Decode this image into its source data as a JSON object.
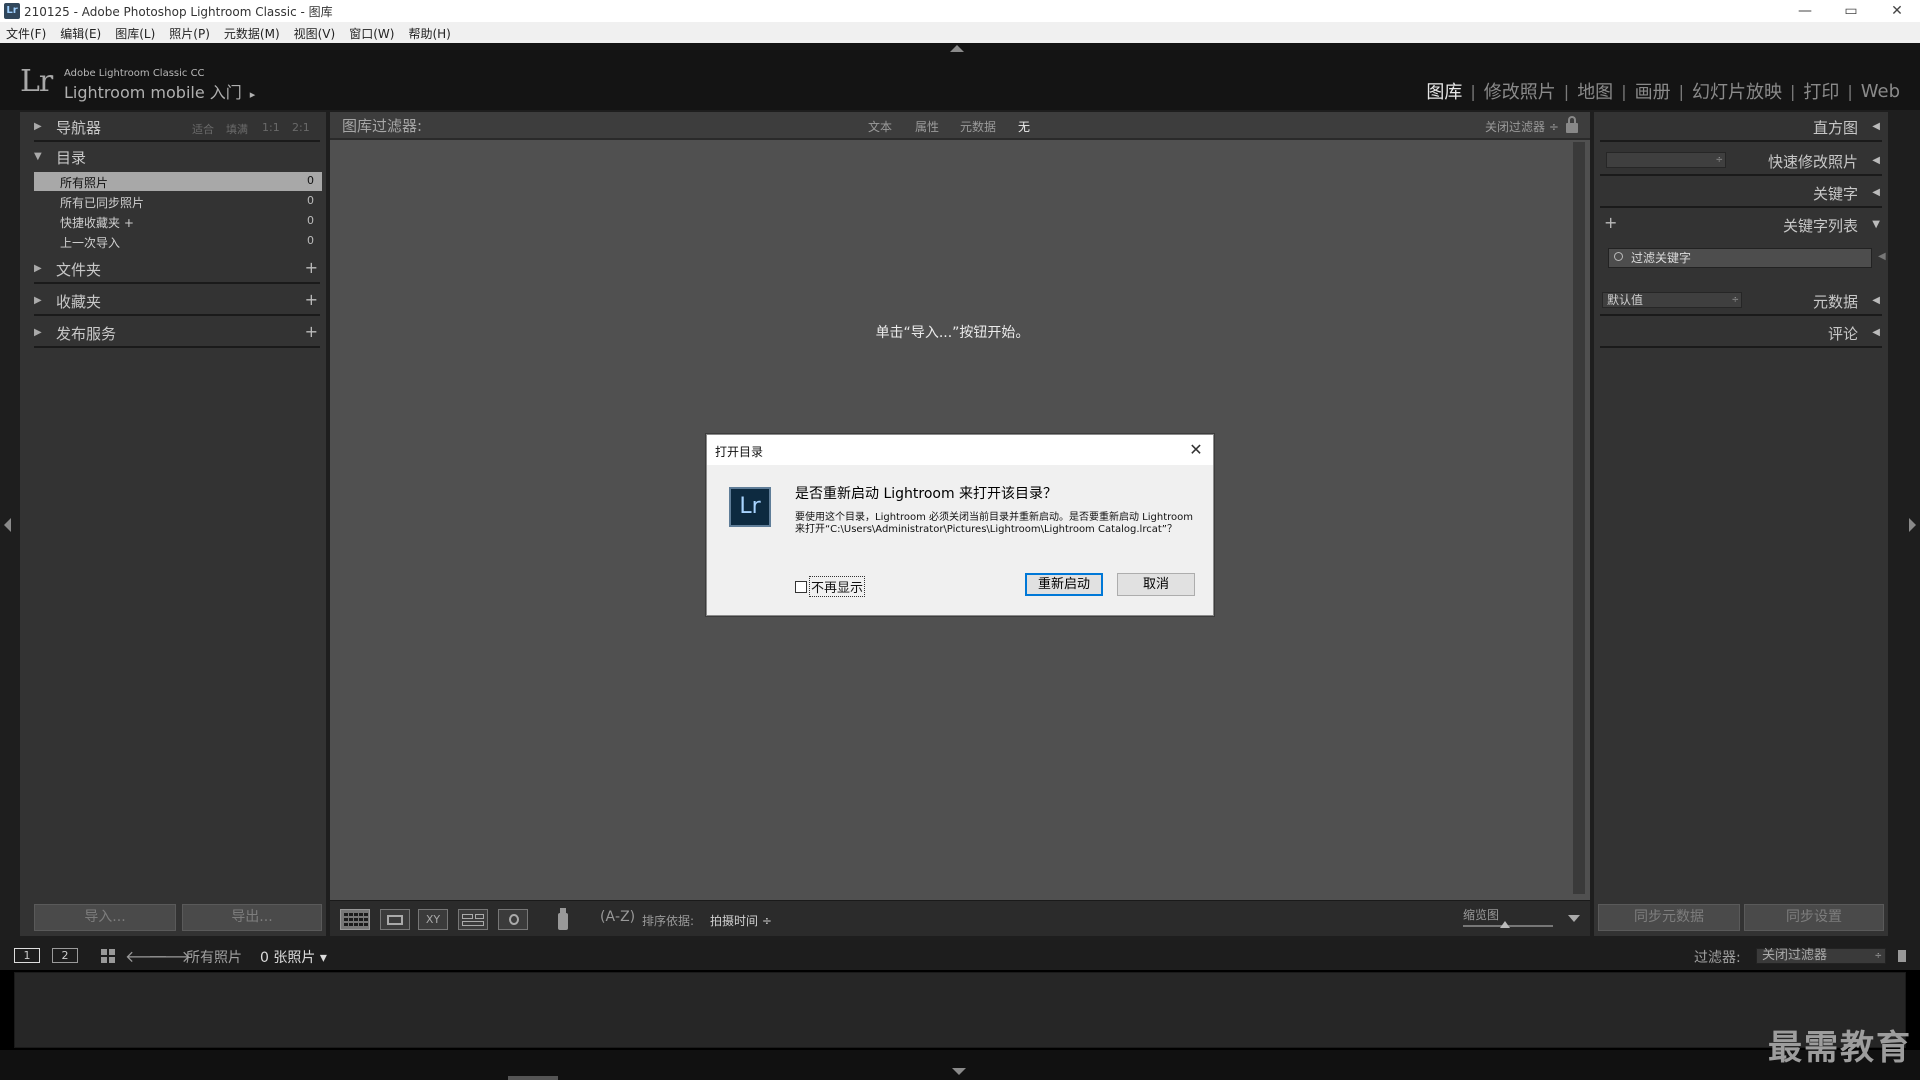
{
  "window": {
    "app_icon": "Lr",
    "title": "210125 - Adobe Photoshop Lightroom Classic - 图库",
    "controls": [
      "—",
      "▭",
      "✕"
    ]
  },
  "menu": [
    "文件(F)",
    "编辑(E)",
    "图库(L)",
    "照片(P)",
    "元数据(M)",
    "视图(V)",
    "窗口(W)",
    "帮助(H)"
  ],
  "identity": {
    "logo": "Lr",
    "product": "Adobe Lightroom Classic CC",
    "mobile": "Lightroom mobile 入门",
    "arrow": "▸"
  },
  "modules": [
    {
      "label": "图库",
      "active": true
    },
    {
      "label": "修改照片"
    },
    {
      "label": "地图"
    },
    {
      "label": "画册"
    },
    {
      "label": "幻灯片放映"
    },
    {
      "label": "打印"
    },
    {
      "label": "Web"
    }
  ],
  "module_separator": "|",
  "left_panel": {
    "navigator": {
      "label": "导航器",
      "zoom": [
        "适合",
        "填满",
        "1:1",
        "2:1"
      ]
    },
    "catalog": {
      "label": "目录",
      "items": [
        {
          "name": "所有照片",
          "count": "0",
          "selected": true
        },
        {
          "name": "所有已同步照片",
          "count": "0"
        },
        {
          "name": "快捷收藏夹 +",
          "count": "0"
        },
        {
          "name": "上一次导入",
          "count": "0"
        }
      ]
    },
    "folders": "文件夹",
    "collections": "收藏夹",
    "publish": "发布服务",
    "plus": "+",
    "import_button": "导入...",
    "export_button": "导出..."
  },
  "filter_bar": {
    "title": "图库过滤器:",
    "options": [
      "文本",
      "属性",
      "元数据",
      "无"
    ],
    "active_option": "无",
    "preset": "关闭过滤器 ÷"
  },
  "center": {
    "hint": "单击“导入...”按钮开始。"
  },
  "toolbar": {
    "compare_label": "XY",
    "sort_icon": "(A‑Z)",
    "sort_label": "排序依据:",
    "sort_value": "拍摄时间 ÷",
    "thumb_label": "缩览图"
  },
  "right_panel": {
    "histogram": "直方图",
    "quick_develop": "快速修改照片",
    "keywording": "关键字",
    "keyword_list": "关键字列表",
    "keyword_filter_placeholder": "过滤关键字",
    "metadata": "元数据",
    "metadata_preset": "默认值",
    "comments": "评论",
    "add": "+",
    "updown": "÷",
    "sync_metadata": "同步元数据",
    "sync_settings": "同步设置"
  },
  "filmstrip": {
    "screen1": "1",
    "screen2": "2",
    "source": "所有照片",
    "count": "0 张照片",
    "count_arrow": "▾",
    "filter_label": "过滤器:",
    "filter_value": "关闭过滤器"
  },
  "watermark": "最需教育",
  "dialog": {
    "title": "打开目录",
    "close": "✕",
    "icon": "Lr",
    "heading": "是否重新启动 Lightroom 来打开该目录？",
    "body": "要使用这个目录，Lightroom 必须关闭当前目录并重新启动。是否要重新启动 Lightroom 来打开“C:\\Users\\Administrator\\Pictures\\Lightroom\\Lightroom Catalog.lrcat”？",
    "checkbox": "不再显示",
    "restart": "重新启动",
    "cancel": "取消"
  }
}
